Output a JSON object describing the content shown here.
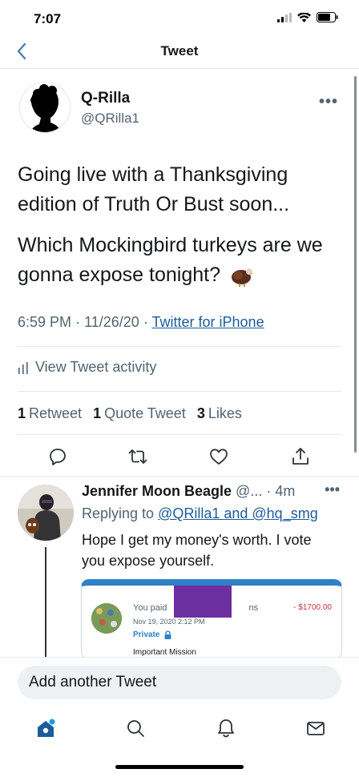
{
  "status_bar": {
    "time": "7:07"
  },
  "nav": {
    "title": "Tweet",
    "back_icon": "chevron-left-icon"
  },
  "tweet": {
    "author_name": "Q-Rilla",
    "author_handle": "@QRilla1",
    "text_line_1": "Going live with a Thanksgiving edition of Truth Or Bust soon...",
    "text_line_2": "Which Mockingbird turkeys are we gonna expose tonight?",
    "time": "6:59 PM",
    "date": "11/26/20",
    "separator": "·",
    "source": "Twitter for iPhone",
    "activity_label": "View Tweet activity",
    "stats": {
      "retweets_count": "1",
      "retweets_label": "Retweet",
      "quotes_count": "1",
      "quotes_label": "Quote Tweet",
      "likes_count": "3",
      "likes_label": "Likes"
    }
  },
  "reply": {
    "author_name": "Jennifer Moon Beagle",
    "author_handle_truncated": "@...",
    "age": "· 4m",
    "replying_prefix": "Replying to",
    "replying_to": "@QRilla1 and @hq_smg",
    "text": "Hope I get my money's worth. I vote you expose yourself.",
    "card": {
      "paid_text": "You paid",
      "paid_suffix": "ns",
      "date": "Nov 19, 2020 2:12 PM",
      "private_label": "Private",
      "amount": "- $1700.00",
      "mission": "Important Mission"
    }
  },
  "compose": {
    "placeholder": "Add another Tweet"
  },
  "colors": {
    "link": "#1d5c9b",
    "accent": "#1d9bf0",
    "tab_active": "#1d5c9b"
  }
}
